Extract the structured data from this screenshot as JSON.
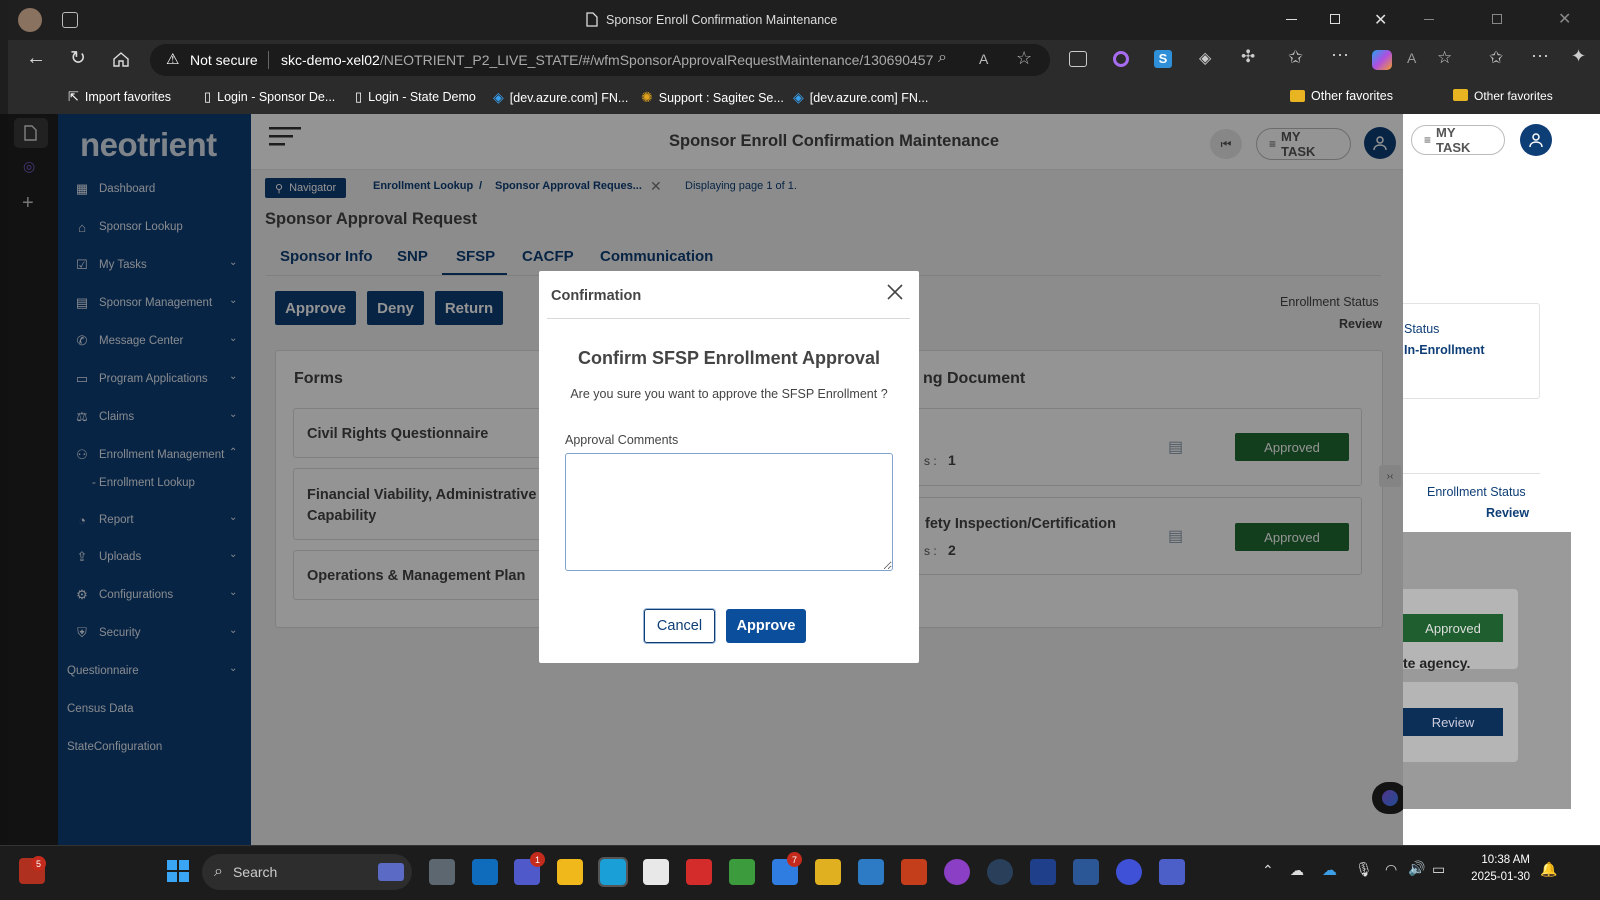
{
  "browser": {
    "window_title": "Sponsor Enroll Confirmation Maintenance",
    "not_secure": "Not secure",
    "url_host": "skc-demo-xel02",
    "url_path": "/NEOTRIENT_P2_LIVE_STATE/#/wfmSponsorApprovalRequestMaintenance/130690457",
    "bookmarks": [
      "Import favorites",
      "Login - Sponsor De...",
      "Login - State Demo",
      "[dev.azure.com] FN...",
      "Support : Sagitec Se...",
      "[dev.azure.com] FN..."
    ],
    "other_favorites": "Other favorites"
  },
  "app": {
    "logo": "neotrient",
    "header_title": "Sponsor Enroll Confirmation Maintenance",
    "my_task": "MY TASK"
  },
  "sidebar": {
    "items": [
      {
        "label": "Dashboard",
        "icon": "grid-icon"
      },
      {
        "label": "Sponsor Lookup",
        "icon": "bank-icon"
      },
      {
        "label": "My Tasks",
        "icon": "tasks-icon"
      },
      {
        "label": "Sponsor Management",
        "icon": "management-icon"
      },
      {
        "label": "Message Center",
        "icon": "phone-icon"
      },
      {
        "label": "Program Applications",
        "icon": "folder-icon"
      },
      {
        "label": "Claims",
        "icon": "claims-icon"
      },
      {
        "label": "Enrollment Management",
        "icon": "user-icon"
      },
      {
        "label": "Report",
        "icon": "chart-icon"
      },
      {
        "label": "Uploads",
        "icon": "upload-icon"
      },
      {
        "label": "Configurations",
        "icon": "gear-icon"
      },
      {
        "label": "Security",
        "icon": "shield-icon"
      },
      {
        "label": "Questionnaire"
      },
      {
        "label": "Census Data"
      },
      {
        "label": "StateConfiguration"
      }
    ],
    "sub_item": "Enrollment Lookup"
  },
  "page": {
    "breadcrumb": {
      "navigator": "Navigator",
      "crumb1": "Enrollment Lookup",
      "sep": "/",
      "crumb2": "Sponsor Approval Reques...",
      "paging": "Displaying page 1 of 1."
    },
    "title": "Sponsor Approval Request",
    "tabs": [
      "Sponsor Info",
      "SNP",
      "SFSP",
      "CACFP",
      "Communication"
    ],
    "actions": [
      "Approve",
      "Deny",
      "Return"
    ],
    "enrollment_status_label": "Enrollment Status",
    "enrollment_status_value": "Review",
    "forms_title": "Forms",
    "forms": [
      "Civil Rights Questionnaire",
      "Financial Viability, Administrative Capability",
      "Operations & Management Plan"
    ],
    "docs_title": "ng Document",
    "docs": [
      {
        "title": "",
        "count_label": "s :",
        "count": "1",
        "status": "Approved"
      },
      {
        "title": "fety Inspection/Certification",
        "count_label": "s :",
        "count": "2",
        "status": "Approved"
      }
    ]
  },
  "bgwindow": {
    "my_task": "MY TASK",
    "status_label": "Status",
    "status_value": "In-Enrollment",
    "enrollment_status_label": "Enrollment Status",
    "enrollment_status_value": "Review",
    "approved": "Approved",
    "agency_text": "te agency.",
    "review_btn": "Review",
    "other_favorites": "Other favorites"
  },
  "modal": {
    "header": "Confirmation",
    "title": "Confirm SFSP Enrollment Approval",
    "question": "Are you sure you want to approve the SFSP Enrollment ?",
    "comments_label": "Approval Comments",
    "comments_value": "",
    "cancel": "Cancel",
    "approve": "Approve"
  },
  "taskbar": {
    "search": "Search",
    "time": "10:38 AM",
    "date": "2025-01-30",
    "badges": {
      "app1": "5",
      "teams": "1",
      "todo": "7"
    }
  },
  "colors": {
    "brand_navy": "#0e3e76",
    "approved_green": "#1f6b35",
    "modal_approve": "#0b4e9b"
  }
}
